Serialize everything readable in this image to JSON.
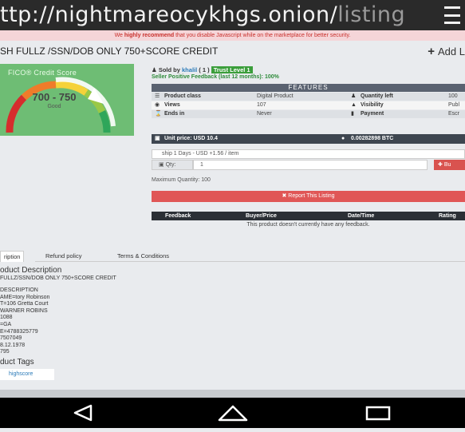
{
  "browser": {
    "url_main": "ttp://nightmareocykhgs.onion/",
    "url_path": "listing",
    "menu_icon": "hamburger-menu-icon"
  },
  "warning": {
    "prefix": "We ",
    "strong": "highly recommend",
    "suffix": " that you disable Javascript while on the marketplace for better security."
  },
  "listing": {
    "title": "SH FULLZ /SSN/DOB ONLY 750+SCORE CREDIT",
    "add_list": "Add L"
  },
  "product_image": {
    "label": "FICO® Credit Score",
    "range": "700 - 750",
    "rating": "Good"
  },
  "seller": {
    "sold_by_label": "Sold by",
    "name": "khalil",
    "count": "( 1 )",
    "trust": "Trust Level 1",
    "feedback": "Seller Positive Feedback (last 12 months): 100%"
  },
  "features": {
    "heading": "FEATURES",
    "rows": [
      {
        "k1": "Product class",
        "v1": "Digital Product",
        "k2": "Quantity left",
        "v2": "100"
      },
      {
        "k1": "Views",
        "v1": "107",
        "k2": "Visibility",
        "v2": "Publ"
      },
      {
        "k1": "Ends in",
        "v1": "Never",
        "k2": "Payment",
        "v2": "Escr"
      }
    ]
  },
  "price": {
    "unit": "Unit price: USD 10.4",
    "btc": "0.00282898 BTC"
  },
  "purchase": {
    "shipping": "ship 1 Days - USD +1.56 / item",
    "qty_label": "Qty:",
    "qty_value": "1",
    "buy_label": "Bu",
    "max_quantity": "Maximum Quantity: 100",
    "report": "Report This Listing"
  },
  "feedback_table": {
    "headers": [
      "Feedback",
      "Buyer/Price",
      "Date/Time",
      "Rating"
    ],
    "empty": "This product doesn't currently have any feedback."
  },
  "tabs": [
    "ription",
    "Refund policy",
    "Terms & Conditions"
  ],
  "description": {
    "heading": "oduct Description",
    "subtitle": "FULLZ/SSN/DOB ONLY 750+SCORE CREDIT",
    "lines": [
      "DESCRIPTION",
      "AME=tory Robinson",
      "T=106 Gretta Court",
      "WARNER ROBINS",
      "1088",
      "=GA",
      "E=4788325779",
      "7507049",
      "8.12.1978",
      "795"
    ]
  },
  "tags": {
    "heading": "duct Tags",
    "items": [
      "highscore"
    ]
  },
  "android_nav": [
    "back-icon",
    "home-icon",
    "recents-icon"
  ]
}
